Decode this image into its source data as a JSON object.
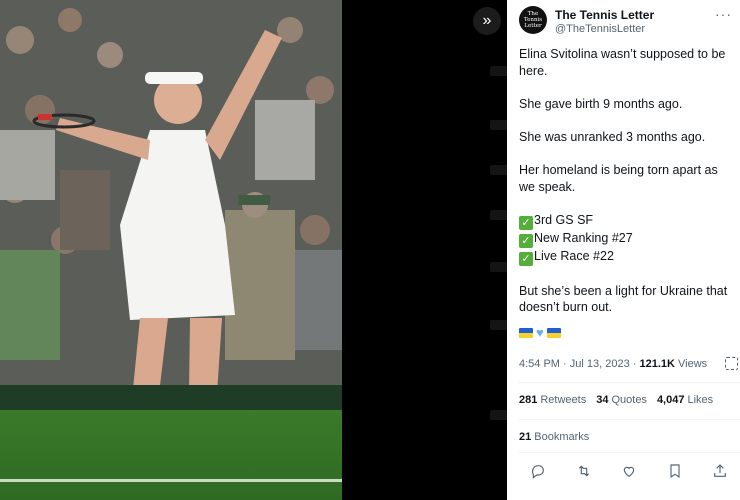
{
  "colors": {
    "panel_bg": "#ffffff",
    "text_primary": "#0f1419",
    "text_secondary": "#536471",
    "check_green": "#55ad3a",
    "ua_blue": "#1f5fd1",
    "ua_yellow": "#f6d12c"
  },
  "author": {
    "avatar_text": "The Tennis Letter",
    "name": "The Tennis Letter",
    "handle": "@TheTennisLetter"
  },
  "tweet": {
    "lines": [
      "Elina Svitolina wasn’t supposed to be here.",
      "She gave birth 9 months ago.",
      "She was unranked 3 months ago.",
      "Her homeland is being torn apart as we speak."
    ],
    "checklist": [
      "3rd GS SF",
      "New Ranking #27",
      "Live Race #22"
    ],
    "closing": "But she’s been a light for Ukraine that doesn’t burn out."
  },
  "meta": {
    "time": "4:54 PM",
    "date": "Jul 13, 2023",
    "views_count": "121.1K",
    "views_label": "Views"
  },
  "stats": {
    "retweets_count": "281",
    "retweets_label": "Retweets",
    "quotes_count": "34",
    "quotes_label": "Quotes",
    "likes_count": "4,047",
    "likes_label": "Likes",
    "bookmarks_count": "21",
    "bookmarks_label": "Bookmarks"
  },
  "icons": {
    "expand": "chevrons-right-icon",
    "more": "more-icon",
    "reply": "reply-icon",
    "retweet": "retweet-icon",
    "like": "heart-icon",
    "bookmark": "bookmark-icon",
    "share": "share-icon",
    "analytics": "analytics-icon"
  }
}
